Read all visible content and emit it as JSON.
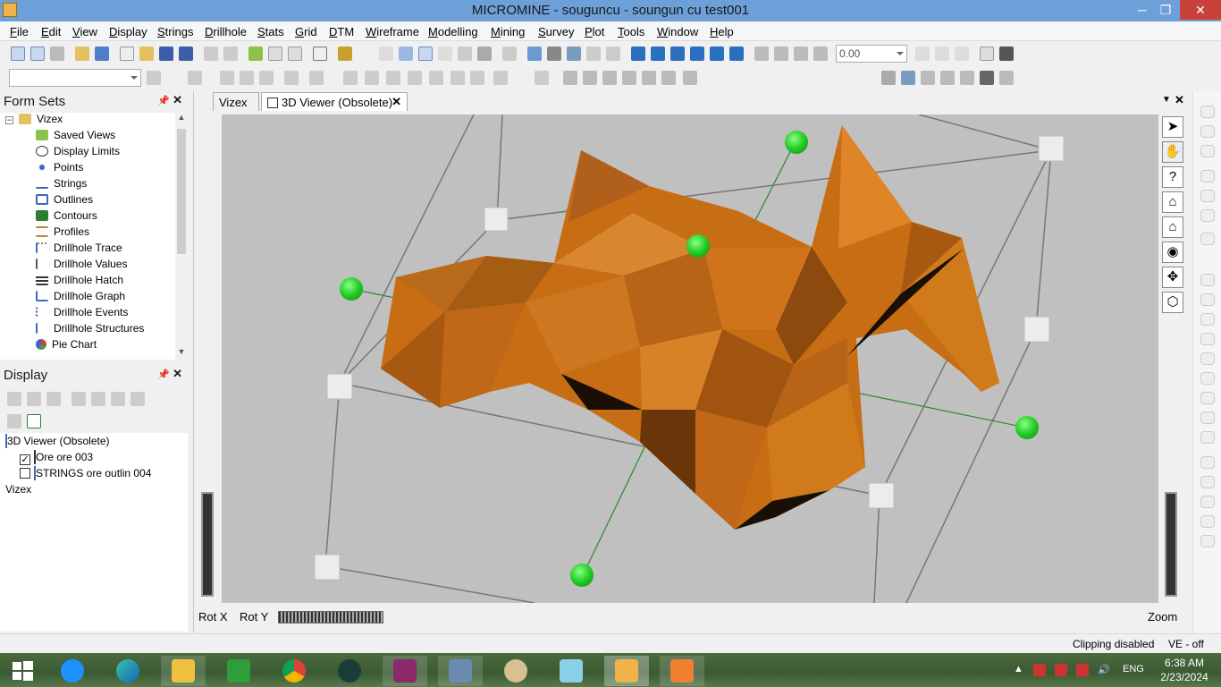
{
  "window": {
    "title": "MICROMINE - souguncu - soungun cu test001",
    "minimize": "─",
    "maximize": "❐",
    "close": "✕"
  },
  "menu": [
    "File",
    "Edit",
    "View",
    "Display",
    "Strings",
    "Drillhole",
    "Stats",
    "Grid",
    "DTM",
    "Wireframe",
    "Modelling",
    "Mining",
    "Survey",
    "Plot",
    "Tools",
    "Window",
    "Help"
  ],
  "toolbar": {
    "zoom_value": "0.00"
  },
  "form_sets": {
    "title": "Form Sets",
    "root": "Vizex",
    "items": [
      "Saved Views",
      "Display Limits",
      "Points",
      "Strings",
      "Outlines",
      "Contours",
      "Profiles",
      "Drillhole Trace",
      "Drillhole Values",
      "Drillhole Hatch",
      "Drillhole Graph",
      "Drillhole Events",
      "Drillhole Structures",
      "Pie Chart"
    ]
  },
  "display": {
    "title": "Display",
    "viewer_node": "3D Viewer (Obsolete)",
    "layers": [
      {
        "label": "Ore ore 003",
        "checked": true
      },
      {
        "label": "STRINGS ore outlin 004",
        "checked": false
      }
    ],
    "vizex_node": "Vizex"
  },
  "tabs": [
    {
      "label": "Vizex",
      "active": false
    },
    {
      "label": "3D Viewer (Obsolete)",
      "active": true
    }
  ],
  "viewer": {
    "solid_color": "#c76d14",
    "handle_color": "#22cc22",
    "background": "#c0c0c0"
  },
  "bottom": {
    "rot_x": "Rot X",
    "rot_y": "Rot Y",
    "zoom": "Zoom"
  },
  "status": {
    "clipping": "Clipping disabled",
    "ve": "VE - off"
  },
  "taskbar": {
    "lang": "ENG",
    "time": "6:38 AM",
    "date": "2/23/2024"
  }
}
